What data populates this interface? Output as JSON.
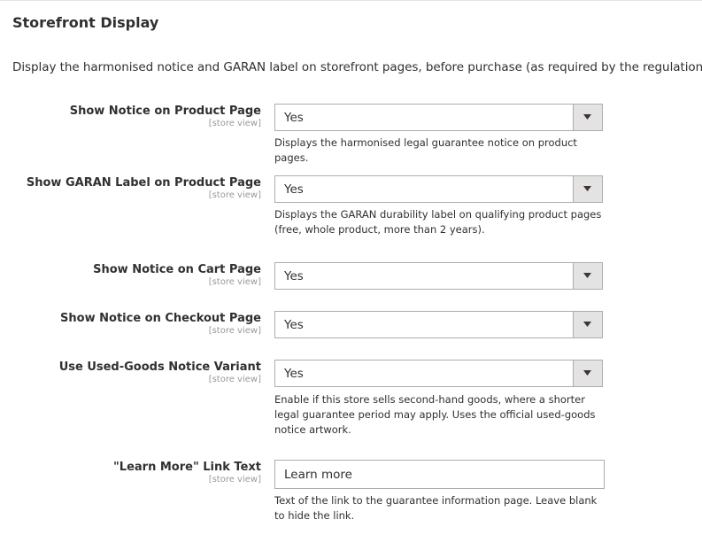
{
  "section": {
    "title": "Storefront Display",
    "description": "Display the harmonised notice and GARAN label on storefront pages, before purchase (as required by the regulation)."
  },
  "fields": [
    {
      "label": "Show Notice on Product Page",
      "scope": "[store view]",
      "value": "Yes",
      "note": "Displays the harmonised legal guarantee notice on product pages."
    },
    {
      "label": "Show GARAN Label on Product Page",
      "scope": "[store view]",
      "value": "Yes",
      "note": "Displays the GARAN durability label on qualifying product pages (free, whole product, more than 2 years)."
    },
    {
      "label": "Show Notice on Cart Page",
      "scope": "[store view]",
      "value": "Yes",
      "note": ""
    },
    {
      "label": "Show Notice on Checkout Page",
      "scope": "[store view]",
      "value": "Yes",
      "note": ""
    },
    {
      "label": "Use Used-Goods Notice Variant",
      "scope": "[store view]",
      "value": "Yes",
      "note": "Enable if this store sells second-hand goods, where a shorter legal guarantee period may apply. Uses the official used-goods notice artwork."
    },
    {
      "label": "\"Learn More\" Link Text",
      "scope": "[store view]",
      "value": "Learn more",
      "note": "Text of the link to the guarantee information page. Leave blank to hide the link."
    }
  ],
  "icons": {
    "select_arrow": "triangle-down-icon"
  },
  "colors": {
    "text": "#303030",
    "scope": "#999999",
    "border": "#adadad",
    "arrow_bg": "#e3e3e3"
  }
}
